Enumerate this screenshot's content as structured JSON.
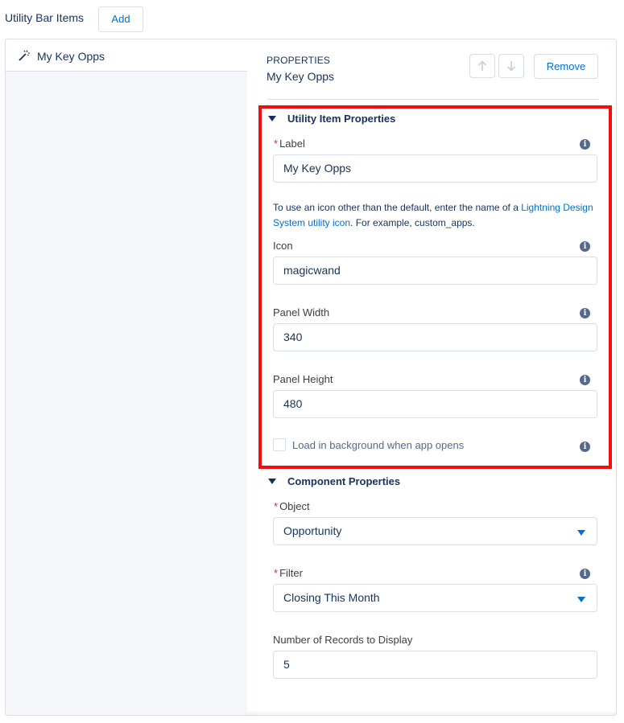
{
  "header": {
    "title": "Utility Bar Items",
    "add_label": "Add"
  },
  "left": {
    "items": [
      {
        "label": "My Key Opps",
        "icon": "magicwand-icon"
      }
    ]
  },
  "properties": {
    "caption": "PROPERTIES",
    "name": "My Key Opps",
    "remove_label": "Remove",
    "move_up_icon": "arrow-up-icon",
    "move_down_icon": "arrow-down-icon"
  },
  "utility_section": {
    "title": "Utility Item Properties",
    "label_field": {
      "label": "Label",
      "required": "*",
      "value": "My Key Opps"
    },
    "help": {
      "prefix": "To use an icon other than the default, enter the name of a ",
      "link": "Lightning Design System utility icon",
      "suffix": ". For example, custom_apps."
    },
    "icon_field": {
      "label": "Icon",
      "value": "magicwand"
    },
    "width_field": {
      "label": "Panel Width",
      "value": "340"
    },
    "height_field": {
      "label": "Panel Height",
      "value": "480"
    },
    "background_checkbox": {
      "label": "Load in background when app opens",
      "checked": false
    }
  },
  "component_section": {
    "title": "Component Properties",
    "object_field": {
      "label": "Object",
      "required": "*",
      "value": "Opportunity"
    },
    "filter_field": {
      "label": "Filter",
      "required": "*",
      "value": "Closing This Month"
    },
    "records_field": {
      "label": "Number of Records to Display",
      "value": "5"
    }
  },
  "colors": {
    "highlight": "#f00e0e",
    "link": "#0070d2",
    "text": "#16325c",
    "border": "#d8dde6"
  }
}
